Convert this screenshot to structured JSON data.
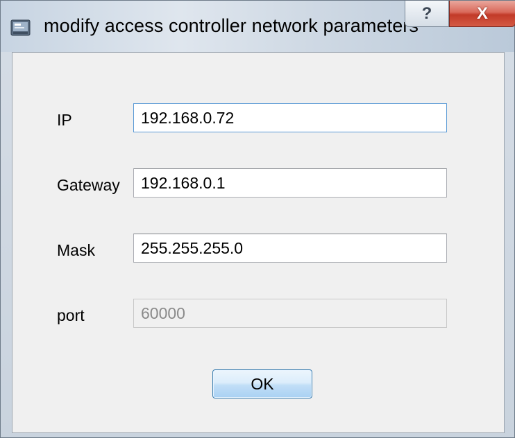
{
  "window": {
    "title": "modify access controller network parameters",
    "help_glyph": "?",
    "close_glyph": "X",
    "icon": "app-window-icon"
  },
  "form": {
    "ip_label": "IP",
    "ip_value": "192.168.0.72",
    "gateway_label": "Gateway",
    "gateway_value": "192.168.0.1",
    "mask_label": "Mask",
    "mask_value": "255.255.255.0",
    "port_label": "port",
    "port_value": "60000"
  },
  "buttons": {
    "ok_label": "OK"
  },
  "colors": {
    "close_button": "#c9412d",
    "ok_button": "#c1def7",
    "dialog_background": "#f0f0f0"
  }
}
